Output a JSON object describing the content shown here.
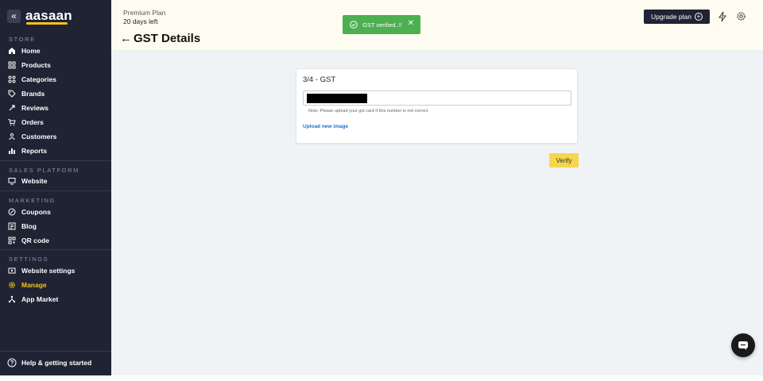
{
  "brand": {
    "logo": "aasaan",
    "collapse_icon": "«"
  },
  "sidebar": {
    "sections": [
      {
        "label": "STORE",
        "items": [
          {
            "label": "Home",
            "icon": "home-icon"
          },
          {
            "label": "Products",
            "icon": "grid-icon"
          },
          {
            "label": "Categories",
            "icon": "categories-icon"
          },
          {
            "label": "Brands",
            "icon": "tag-icon"
          },
          {
            "label": "Reviews",
            "icon": "reviews-icon"
          },
          {
            "label": "Orders",
            "icon": "cart-icon"
          },
          {
            "label": "Customers",
            "icon": "users-icon"
          },
          {
            "label": "Reports",
            "icon": "bar-chart-icon"
          }
        ]
      },
      {
        "label": "SALES PLATFORM",
        "items": [
          {
            "label": "Website",
            "icon": "monitor-icon"
          }
        ]
      },
      {
        "label": "MARKETING",
        "items": [
          {
            "label": "Coupons",
            "icon": "coupon-icon"
          },
          {
            "label": "Blog",
            "icon": "blog-icon"
          },
          {
            "label": "QR code",
            "icon": "qr-icon"
          }
        ]
      },
      {
        "label": "SETTINGS",
        "items": [
          {
            "label": "Website settings",
            "icon": "website-settings-icon"
          },
          {
            "label": "Manage",
            "icon": "gear-icon",
            "active": true
          },
          {
            "label": "App Market",
            "icon": "app-market-icon"
          }
        ]
      }
    ],
    "help": "Help & getting started"
  },
  "topbar": {
    "plan_name": "Premium Plan",
    "plan_days": "20 days left",
    "back": "←",
    "title": "GST Details",
    "upgrade_label": "Upgrade plan",
    "upgrade_plus": "+"
  },
  "toast": {
    "message": "GST verified..!!",
    "close": "✕"
  },
  "card": {
    "title": "3/4 - GST",
    "note": "Note: Please upload your gst card if this number is not correct",
    "upload_link": "Upload new image"
  },
  "verify_label": "Verify",
  "colors": {
    "sidebar_bg": "#1f2333",
    "accent": "#f5c518",
    "toast_bg": "#4caf50",
    "verify_bg": "#f7d64a",
    "link": "#1f6fd1",
    "main_bg": "#f0f3f6",
    "topbar_bg": "#fefcf1"
  }
}
